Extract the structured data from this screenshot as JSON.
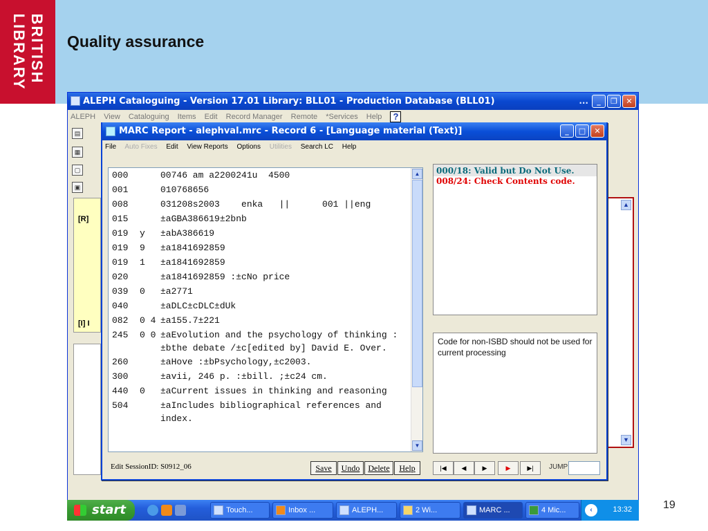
{
  "slide": {
    "title": "Quality assurance",
    "page_number": "19",
    "logo_line1": "BRITISH",
    "logo_line2": "LIBRARY"
  },
  "aleph": {
    "title": "ALEPH Cataloguing - Version 17.01        Library:  BLL01 - Production Database (BLL01)",
    "title_ellipsis": "...",
    "menu": [
      "ALEPH",
      "View",
      "Cataloguing",
      "Items",
      "Edit",
      "Record Manager",
      "Remote",
      "*Services",
      "Help"
    ],
    "help_icon_label": "?",
    "tree_label": "[R]",
    "tree_label2": "[I] I"
  },
  "marc": {
    "title": "MARC Report - alephval.mrc - Record 6 -  [Language material (Text)]",
    "menu": [
      {
        "label": "File",
        "disabled": false
      },
      {
        "label": "Auto Fixes",
        "disabled": true
      },
      {
        "label": "Edit",
        "disabled": false
      },
      {
        "label": "View Reports",
        "disabled": false
      },
      {
        "label": "Options",
        "disabled": false
      },
      {
        "label": "Utilities",
        "disabled": true
      },
      {
        "label": "Search LC",
        "disabled": false
      },
      {
        "label": "Help",
        "disabled": false
      }
    ],
    "fields": [
      {
        "tag": "000",
        "ind": "",
        "data": "00746 am a2200241u  4500"
      },
      {
        "tag": "001",
        "ind": "",
        "data": "010768656"
      },
      {
        "tag": "008",
        "ind": "",
        "data": "031208s2003    enka   ||      001 ||eng"
      },
      {
        "tag": "015",
        "ind": "",
        "data": "±aGBA386619±2bnb"
      },
      {
        "tag": "019",
        "ind": "y",
        "data": "±abA386619"
      },
      {
        "tag": "019",
        "ind": "9",
        "data": "±a1841692859"
      },
      {
        "tag": "019",
        "ind": "1",
        "data": "±a1841692859"
      },
      {
        "tag": "020",
        "ind": "",
        "data": "±a1841692859 :±cNo price"
      },
      {
        "tag": "039",
        "ind": "0",
        "data": "±a2771"
      },
      {
        "tag": "040",
        "ind": "",
        "data": "±aDLC±cDLC±dUk"
      },
      {
        "tag": "082",
        "ind": "0 4",
        "data": "±a155.7±221"
      },
      {
        "tag": "245",
        "ind": "0 0",
        "data": "±aEvolution and the psychology of thinking :±bthe debate /±c[edited by] David E. Over."
      },
      {
        "tag": "260",
        "ind": "",
        "data": "±aHove :±bPsychology,±c2003."
      },
      {
        "tag": "300",
        "ind": "",
        "data": "±avii, 246 p. :±bill. ;±c24 cm."
      },
      {
        "tag": "440",
        "ind": "  0",
        "data": "±aCurrent issues in thinking and reasoning"
      },
      {
        "tag": "504",
        "ind": "",
        "data": "±aIncludes bibliographical references and index."
      }
    ],
    "errors": [
      {
        "text": "000/18: Valid but Do Not Use.",
        "color": "#0a6a7a"
      },
      {
        "text": "008/24: Check Contents code.",
        "color": "#e00000"
      }
    ],
    "explanation": "Code for non-ISBD should not be used for current processing",
    "session_id": "Edit SessionID: S0912_06",
    "buttons": {
      "save": "Save",
      "undo": "Undo",
      "delete": "Delete",
      "help": "Help"
    },
    "nav": {
      "first": "|◀",
      "prev": "◀",
      "play": "▶",
      "next": "▶",
      "last": "▶|"
    },
    "jump_label": "JUMP:"
  },
  "taskbar": {
    "start": "start",
    "tasks": [
      {
        "label": "Touch...",
        "active": false
      },
      {
        "label": "Inbox ...",
        "active": false
      },
      {
        "label": "ALEPH...",
        "active": false
      },
      {
        "label": "2 Wi...",
        "active": false
      },
      {
        "label": "MARC ...",
        "active": true
      },
      {
        "label": "4 Mic...",
        "active": false
      }
    ],
    "time": "13:32"
  }
}
